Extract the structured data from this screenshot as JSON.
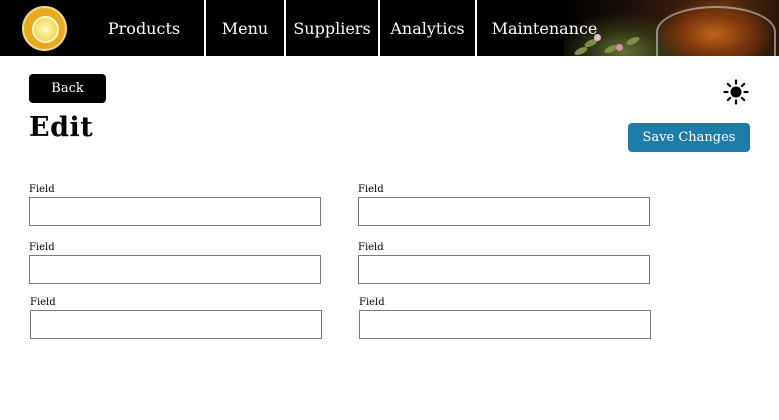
{
  "nav": {
    "items": [
      {
        "label": "Products"
      },
      {
        "label": "Menu"
      },
      {
        "label": "Suppliers"
      },
      {
        "label": "Analytics"
      },
      {
        "label": "Maintenance"
      }
    ],
    "bg_color": "#000000"
  },
  "page": {
    "back_label": "Back",
    "title": "Edit",
    "save_label": "Save Changes",
    "save_color": "#1e7ca8",
    "theme_icon": "sun-icon"
  },
  "form": {
    "fields": [
      {
        "label": "Field",
        "value": ""
      },
      {
        "label": "Field",
        "value": ""
      },
      {
        "label": "Field",
        "value": ""
      },
      {
        "label": "Field",
        "value": ""
      },
      {
        "label": "Field",
        "value": ""
      },
      {
        "label": "Field",
        "value": ""
      }
    ]
  }
}
